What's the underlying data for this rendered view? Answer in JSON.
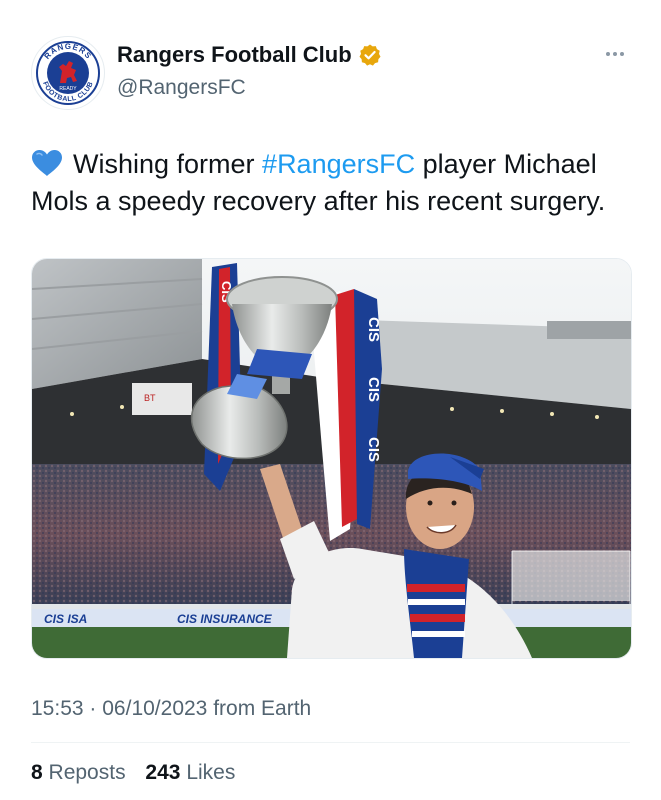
{
  "author": {
    "display_name": "Rangers Football Club",
    "handle": "@RangersFC",
    "verified_badge_color": "#e8a70c",
    "avatar_logo": "rangers-crest",
    "avatar_text_top": "RANGERS",
    "avatar_text_bottom": "FOOTBALL CLUB",
    "avatar_text_motto": "READY"
  },
  "tweet": {
    "emoji": "blue-heart-icon",
    "text_before": "Wishing former ",
    "hashtag": "#RangersFC",
    "text_after": " player Michael Mols a speedy recovery after his recent surgery."
  },
  "media": {
    "scarf_text": "CIS",
    "ad_board_left": "CIS ISA",
    "ad_board_right": "CIS INSURANCE",
    "stand_sign": "BT"
  },
  "meta": {
    "time": "15:53",
    "separator": "·",
    "date": "06/10/2023",
    "source": "from Earth"
  },
  "stats": {
    "reposts_count": "8",
    "reposts_label": "Reposts",
    "likes_count": "243",
    "likes_label": "Likes"
  },
  "colors": {
    "link": "#1d9bf0",
    "secondary_text": "#536471",
    "primary_text": "#0f1419",
    "rangers_blue": "#1b3f94",
    "rangers_red": "#d2232a"
  }
}
